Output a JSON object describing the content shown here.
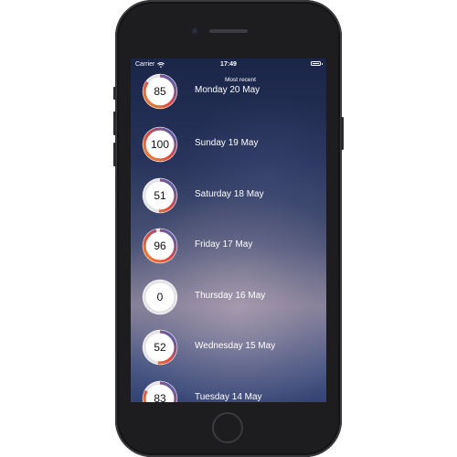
{
  "statusbar": {
    "carrier": "Carrier",
    "time": "17:49"
  },
  "section_title": "Most recent",
  "colors": {
    "ring_blue": "#3a5fc4",
    "ring_red": "#e2483f",
    "ring_orange": "#f08a2c",
    "ring_track": "#e4e4e6"
  },
  "entries": [
    {
      "score": "85",
      "date": "Monday 20 May",
      "progress": 0.85
    },
    {
      "score": "100",
      "date": "Sunday 19 May",
      "progress": 1.0
    },
    {
      "score": "51",
      "date": "Saturday 18 May",
      "progress": 0.51
    },
    {
      "score": "96",
      "date": "Friday 17 May",
      "progress": 0.96
    },
    {
      "score": "0",
      "date": "Thursday 16 May",
      "progress": 0.0
    },
    {
      "score": "52",
      "date": "Wednesday 15 May",
      "progress": 0.52
    },
    {
      "score": "83",
      "date": "Tuesday 14 May",
      "progress": 0.83
    }
  ]
}
